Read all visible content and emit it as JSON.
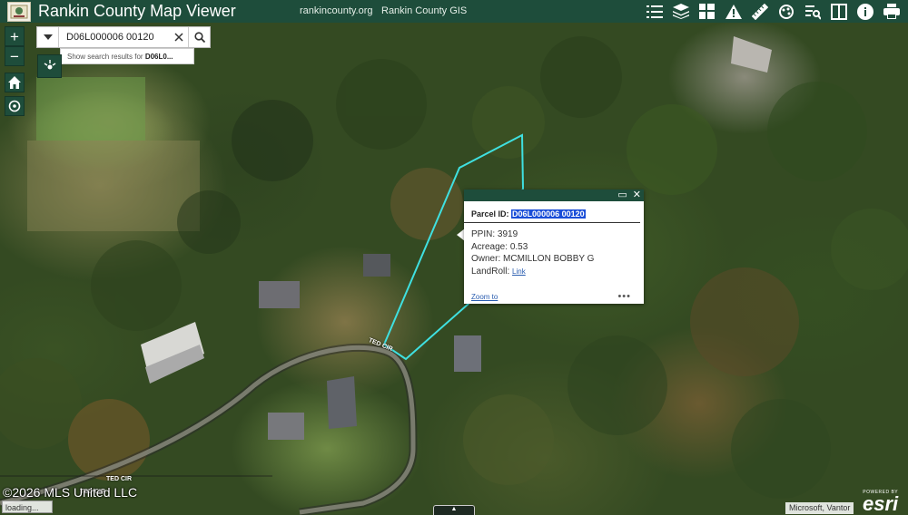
{
  "header": {
    "logo_icon": "rankin-county-seal-icon",
    "title": "Rankin County Map Viewer",
    "links": [
      "rankincounty.org",
      "Rankin County GIS"
    ],
    "background": "#1e4d3b",
    "tools": [
      "layer-list-icon",
      "layers-icon",
      "basemap-gallery-icon",
      "warning-icon",
      "measure-icon",
      "draw-icon",
      "query-icon",
      "compare-icon",
      "about-icon",
      "print-icon"
    ]
  },
  "map_controls": {
    "zoom_in": "+",
    "zoom_out": "−"
  },
  "search": {
    "value": "D06L000006 00120",
    "suggestion_prefix": "Show search results for ",
    "suggestion_term": "D06L0..."
  },
  "road_labels": [
    "TED CIR",
    "TED CIR",
    "TED CIR"
  ],
  "popup": {
    "title_label": "Parcel ID:",
    "parcel_id": "D06L000006 00120",
    "ppin_label": "PPIN:",
    "ppin": "3919",
    "acreage_label": "Acreage:",
    "acreage": "0.53",
    "owner_label": "Owner:",
    "owner": "MCMILLON BOBBY G",
    "landroll_label": "LandRoll:",
    "landroll_link": "Link",
    "zoom_to": "Zoom to",
    "more": "•••"
  },
  "footer": {
    "watermark": "©2026 MLS United LLC",
    "loading": "loading...",
    "attribution": "Microsoft, Vantor",
    "esri_powered": "POWERED BY",
    "esri_word": "esri"
  },
  "colors": {
    "parcel_outline": "#3fe0e0",
    "selection_highlight": "#1a4ed8"
  }
}
